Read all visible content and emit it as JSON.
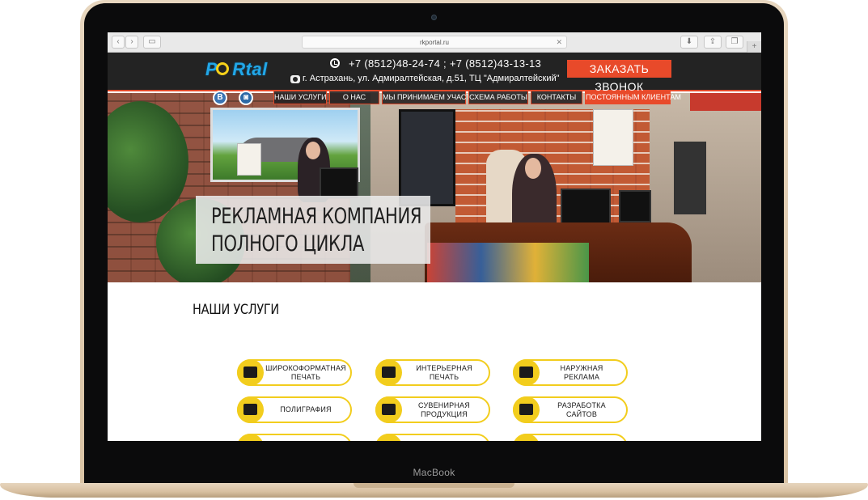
{
  "device": {
    "label": "MacBook"
  },
  "browser": {
    "url": "rkportal.ru",
    "back_icon": "chevron-left-icon",
    "forward_icon": "chevron-right-icon",
    "sidebar_icon": "sidebar-icon",
    "download_icon": "download-icon",
    "share_icon": "share-icon",
    "tabs_icon": "tabs-icon",
    "new_tab": "+",
    "close": "✕"
  },
  "header": {
    "logo_part1": "P",
    "logo_part2": "Rtal",
    "phone": "+7 (8512)48-24-74 ; +7 (8512)43-13-13",
    "address": "г. Астрахань, ул. Адмиралтейская, д.51, ТЦ \"Адмиралтейский\"",
    "callback_label": "ЗАКАЗАТЬ ЗВОНОК",
    "accent_color": "#e84a2a"
  },
  "social": {
    "vk": "B",
    "instagram": "◙"
  },
  "nav": [
    {
      "label": "НАШИ УСЛУГИ"
    },
    {
      "label": "О НАС"
    },
    {
      "label": "МЫ ПРИНИМАЕМ УЧАСТИЕ"
    },
    {
      "label": "СХЕМА РАБОТЫ"
    },
    {
      "label": "КОНТАКТЫ"
    },
    {
      "label": "ПОСТОЯННЫМ КЛИЕНТАМ"
    }
  ],
  "hero": {
    "line1": "РЕКЛАМНАЯ КОМПАНИЯ",
    "line2": "ПОЛНОГО ЦИКЛА"
  },
  "services": {
    "title": "НАШИ УСЛУГИ",
    "accent_color": "#f2cd1d",
    "items": [
      {
        "label": "ШИРОКОФОРМАТНАЯ ПЕЧАТЬ",
        "icon": "printer-icon"
      },
      {
        "label": "ИНТЕРЬЕРНАЯ ПЕЧАТЬ",
        "icon": "picture-icon"
      },
      {
        "label": "НАРУЖНАЯ РЕКЛАМА",
        "icon": "billboard-icon"
      },
      {
        "label": "ПОЛИГРАФИЯ",
        "icon": "brochure-icon"
      },
      {
        "label": "СУВЕНИРНАЯ ПРОДУКЦИЯ",
        "icon": "gift-icon"
      },
      {
        "label": "РАЗРАБОТКА САЙТОВ",
        "icon": "code-monitor-icon"
      }
    ]
  }
}
